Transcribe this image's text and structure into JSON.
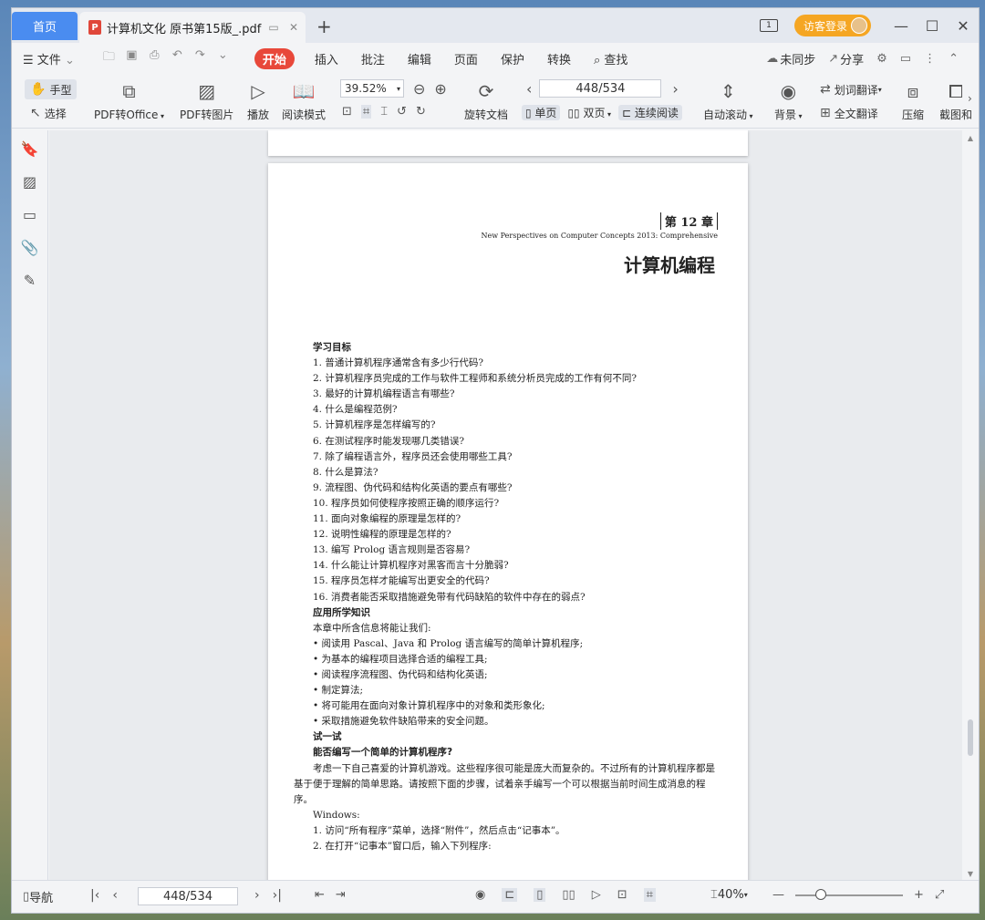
{
  "tabs": {
    "home": "首页",
    "doc_title": "计算机文化 原书第15版_.pdf",
    "doc_badge": "P"
  },
  "window": {
    "login": "访客登录"
  },
  "menu": {
    "file": "文件",
    "start": "开始",
    "items": [
      "插入",
      "批注",
      "编辑",
      "页面",
      "保护",
      "转换"
    ],
    "search": "查找",
    "unsync": "未同步",
    "share": "分享"
  },
  "toolbar": {
    "hand": "手型",
    "select": "选择",
    "pdf_to_office": "PDF转Office",
    "pdf_to_image": "PDF转图片",
    "play": "播放",
    "read_mode": "阅读模式",
    "zoom": "39.52%",
    "page": "448/534",
    "rotate_doc": "旋转文档",
    "single": "单页",
    "double": "双页",
    "continuous": "连续阅读",
    "auto_scroll": "自动滚动",
    "background": "背景",
    "word_translate": "划词翻译",
    "full_translate": "全文翻译",
    "compress": "压缩",
    "screenshot": "截图和"
  },
  "page": {
    "chapter": "第 12 章",
    "subtitle": "New Perspectives on Computer Concepts 2013: Comprehensive",
    "title": "计算机编程",
    "goals_heading": "学习目标",
    "goals": [
      "1. 普通计算机程序通常含有多少行代码?",
      "2. 计算机程序员完成的工作与软件工程师和系统分析员完成的工作有何不同?",
      "3. 最好的计算机编程语言有哪些?",
      "4. 什么是编程范例?",
      "5. 计算机程序是怎样编写的?",
      "6. 在测试程序时能发现哪几类错误?",
      "7. 除了编程语言外，程序员还会使用哪些工具?",
      "8. 什么是算法?",
      "9. 流程图、伪代码和结构化英语的要点有哪些?",
      "10. 程序员如何使程序按照正确的顺序运行?",
      "11. 面向对象编程的原理是怎样的?",
      "12. 说明性编程的原理是怎样的?",
      "13. 编写 Prolog 语言规则是否容易?",
      "14. 什么能让计算机程序对黑客而言十分脆弱?",
      "15. 程序员怎样才能编写出更安全的代码?",
      "16. 消费者能否采取措施避免带有代码缺陷的软件中存在的弱点?"
    ],
    "apply_heading": "应用所学知识",
    "apply_intro": "本章中所含信息将能让我们:",
    "apply_items": [
      "• 阅读用 Pascal、Java 和 Prolog 语言编写的简单计算机程序;",
      "• 为基本的编程项目选择合适的编程工具;",
      "• 阅读程序流程图、伪代码和结构化英语;",
      "• 制定算法;",
      "• 将可能用在面向对象计算机程序中的对象和类形象化;",
      "• 采取措施避免软件缺陷带来的安全问题。"
    ],
    "try_heading": "试一试",
    "try_sub": "能否编写一个简单的计算机程序?",
    "try_para": "考虑一下自己喜爱的计算机游戏。这些程序很可能是庞大而复杂的。不过所有的计算机程序都是基于便于理解的简单思路。请按照下面的步骤，试着亲手编写一个可以根据当前时间生成消息的程序。",
    "windows": "Windows:",
    "steps": [
      "1. 访问“所有程序”菜单，选择“附件”，然后点击“记事本”。",
      "2. 在打开“记事本”窗口后，输入下列程序:"
    ]
  },
  "status": {
    "nav": "导航",
    "page": "448/534",
    "zoom": "40%"
  }
}
